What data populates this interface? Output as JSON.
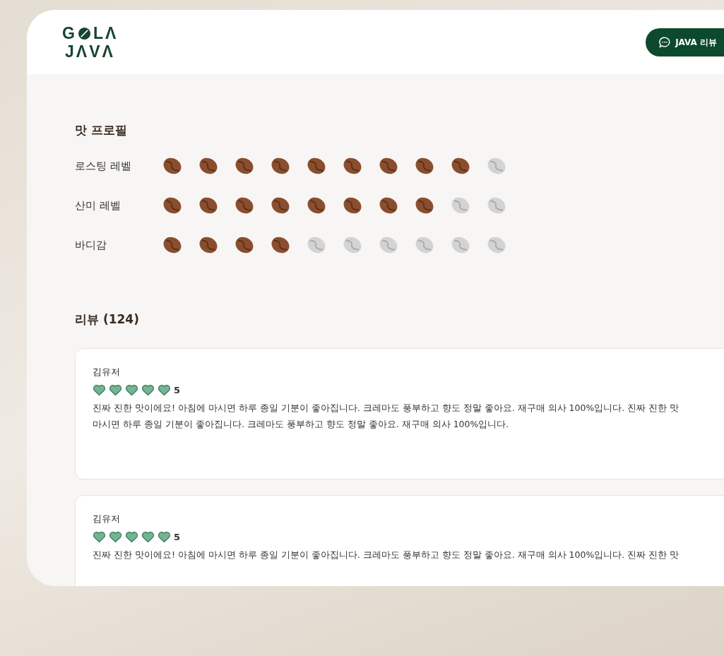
{
  "header": {
    "logo_top": [
      "G",
      "LΛ"
    ],
    "logo_bottom": "JΛVΛ",
    "review_button": "JAVA 리뷰"
  },
  "taste_profile": {
    "title": "맛 프로필",
    "rows": [
      {
        "label": "로스팅 레벨",
        "stars": 9
      },
      {
        "label": "산미 레벨",
        "stars": 8
      },
      {
        "label": "바디감",
        "stars": 4
      }
    ]
  },
  "reviews": {
    "title": "리뷰 (124)",
    "items": [
      {
        "author": "김유저",
        "stars": 5,
        "rating": "5",
        "lines": [
          "진짜 진한 맛이에요! 아침에 마시면 하루 종일 기분이 좋아집니다. 크레마도 풍부하고 향도 정말 좋아요. 재구매 의사 100%입니다. 진짜 진한 맛",
          "마시면 하루 종일 기분이 좋아집니다. 크레마도 풍부하고 향도 정말 좋아요. 재구매 의사 100%입니다."
        ]
      },
      {
        "author": "김유저",
        "stars": 5,
        "rating": "5",
        "lines": [
          "진짜 진한 맛이에요! 아침에 마시면 하루 종일 기분이 좋아집니다. 크레마도 풍부하고 향도 정말 좋아요. 재구매 의사 100%입니다. 진짜 진한 맛"
        ]
      }
    ]
  }
}
